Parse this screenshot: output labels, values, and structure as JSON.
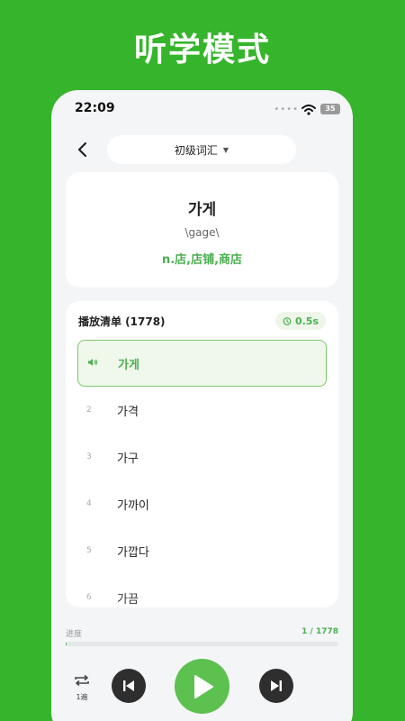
{
  "banner": {
    "title": "听学模式"
  },
  "status": {
    "time": "22:09",
    "battery": "35"
  },
  "nav": {
    "level": "初级词汇"
  },
  "word": {
    "text": "가게",
    "phonetic": "\\gage\\",
    "meaning": "n.店,店铺,商店"
  },
  "playlist": {
    "title": "播放清单 (1778)",
    "speed": "0.5s",
    "items": [
      {
        "num": "",
        "text": "가게",
        "active": true
      },
      {
        "num": "2",
        "text": "가격"
      },
      {
        "num": "3",
        "text": "가구"
      },
      {
        "num": "4",
        "text": "가까이"
      },
      {
        "num": "5",
        "text": "가깝다"
      },
      {
        "num": "6",
        "text": "가끔"
      }
    ]
  },
  "progress": {
    "label": "进度",
    "count": "1 / 1778",
    "fraction": 0.00056
  },
  "controls": {
    "repeat_label": "1遍"
  },
  "colors": {
    "brand": "#36b52c",
    "accent": "#4caf50"
  }
}
